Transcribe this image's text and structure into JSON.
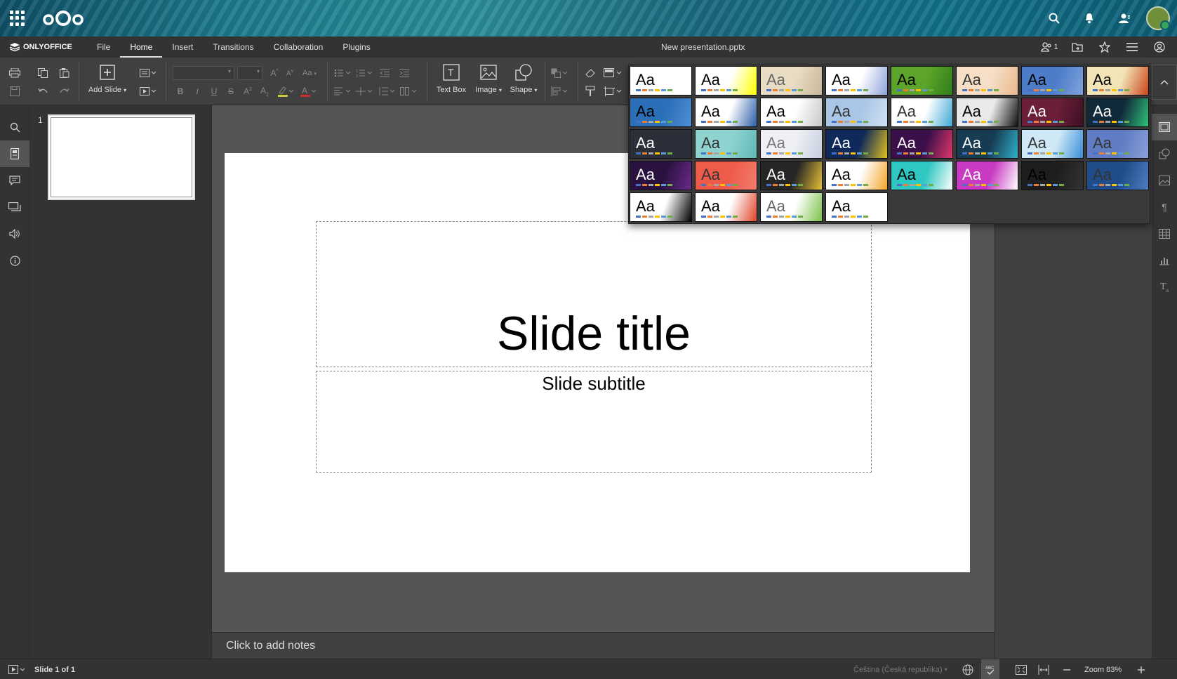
{
  "app": {
    "brand": "ONLYOFFICE",
    "document_title": "New presentation.pptx",
    "coauthors_count": "1"
  },
  "tabs": [
    {
      "label": "File"
    },
    {
      "label": "Home"
    },
    {
      "label": "Insert"
    },
    {
      "label": "Transitions"
    },
    {
      "label": "Collaboration"
    },
    {
      "label": "Plugins"
    }
  ],
  "active_tab": "Home",
  "toolbar": {
    "add_slide_label": "Add Slide",
    "text_box_label": "Text Box",
    "image_label": "Image",
    "shape_label": "Shape"
  },
  "slides": [
    {
      "number": "1"
    }
  ],
  "slide": {
    "title": "Slide title",
    "subtitle": "Slide subtitle"
  },
  "notes": {
    "placeholder": "Click to add notes"
  },
  "status": {
    "slide_counter": "Slide 1 of 1",
    "language": "Čeština (Česká republika)",
    "zoom": "Zoom 83%"
  },
  "themes": [
    {
      "bg": "#ffffff",
      "fg": "#000",
      "accent": "#ffffff"
    },
    {
      "bg": "#ffffff",
      "fg": "#000",
      "accent": "#ff0"
    },
    {
      "bg": "#e9dcc4",
      "fg": "#666",
      "accent": "#c9b799"
    },
    {
      "bg": "#ffffff",
      "fg": "#000",
      "accent": "#8ea3d9"
    },
    {
      "bg": "#5da52a",
      "fg": "#000",
      "accent": "#2e7d1a"
    },
    {
      "bg": "#f6dfc6",
      "fg": "#333",
      "accent": "#e9b88d"
    },
    {
      "bg": "#4d7cc9",
      "fg": "#000",
      "accent": "#7fa3dd"
    },
    {
      "bg": "#f3e4b5",
      "fg": "#000",
      "accent": "#c9451c"
    },
    {
      "bg": "#2b6fb8",
      "fg": "#000",
      "accent": "#4d8fd6"
    },
    {
      "bg": "#ffffff",
      "fg": "#000",
      "accent": "#2b5fa8"
    },
    {
      "bg": "#ffffff",
      "fg": "#000",
      "accent": "#c8c8c8"
    },
    {
      "bg": "#a9c6e6",
      "fg": "#333",
      "accent": "#cfe0f2"
    },
    {
      "bg": "#ffffff",
      "fg": "#333",
      "accent": "#3fa7d6"
    },
    {
      "bg": "#eaeaea",
      "fg": "#000",
      "accent": "#111"
    },
    {
      "bg": "#6b1f3a",
      "fg": "#fff",
      "accent": "#3d0f22"
    },
    {
      "bg": "#112a3a",
      "fg": "#fff",
      "accent": "#2fc27a"
    },
    {
      "bg": "#2a2f3a",
      "fg": "#fff",
      "accent": "#2a2f3a"
    },
    {
      "bg": "#8ed3d0",
      "fg": "#333",
      "accent": "#5fb9b6"
    },
    {
      "bg": "#eef0f4",
      "fg": "#777",
      "accent": "#c5cde0"
    },
    {
      "bg": "#0f2a5a",
      "fg": "#fff",
      "accent": "#e0c020"
    },
    {
      "bg": "#3a0f4a",
      "fg": "#fff",
      "accent": "#e0386a"
    },
    {
      "bg": "#173b53",
      "fg": "#fff",
      "accent": "#2fb2c9"
    },
    {
      "bg": "#cfe8f6",
      "fg": "#333",
      "accent": "#3b8fd9"
    },
    {
      "bg": "#5f7cc4",
      "fg": "#333",
      "accent": "#8ba2d8"
    },
    {
      "bg": "#2a1240",
      "fg": "#fff",
      "accent": "#6a2a8a"
    },
    {
      "bg": "#ef5b4a",
      "fg": "#333",
      "accent": "#f27d6d"
    },
    {
      "bg": "#262626",
      "fg": "#fff",
      "accent": "#e5c035"
    },
    {
      "bg": "#ffffff",
      "fg": "#000",
      "accent": "#f2a52b"
    },
    {
      "bg": "#2fc7c1",
      "fg": "#000",
      "accent": "#ffffff"
    },
    {
      "bg": "#c73ac2",
      "fg": "#fff",
      "accent": "#ffffff"
    },
    {
      "bg": "#1e1e1e",
      "fg": "#000",
      "accent": "#333"
    },
    {
      "bg": "#1f4d8a",
      "fg": "#333",
      "accent": "#4f7cbf"
    },
    {
      "bg": "#ffffff",
      "fg": "#000",
      "accent": "#000"
    },
    {
      "bg": "#ffffff",
      "fg": "#000",
      "accent": "#e0452b"
    },
    {
      "bg": "#ffffff",
      "fg": "#666",
      "accent": "#7cc24a"
    },
    {
      "bg": "#ffffff",
      "fg": "#000",
      "accent": "#ffffff"
    }
  ],
  "colors": {
    "toolbar_bg": "#404040",
    "canvas_bg": "#555555",
    "panel_bg": "#333333"
  }
}
